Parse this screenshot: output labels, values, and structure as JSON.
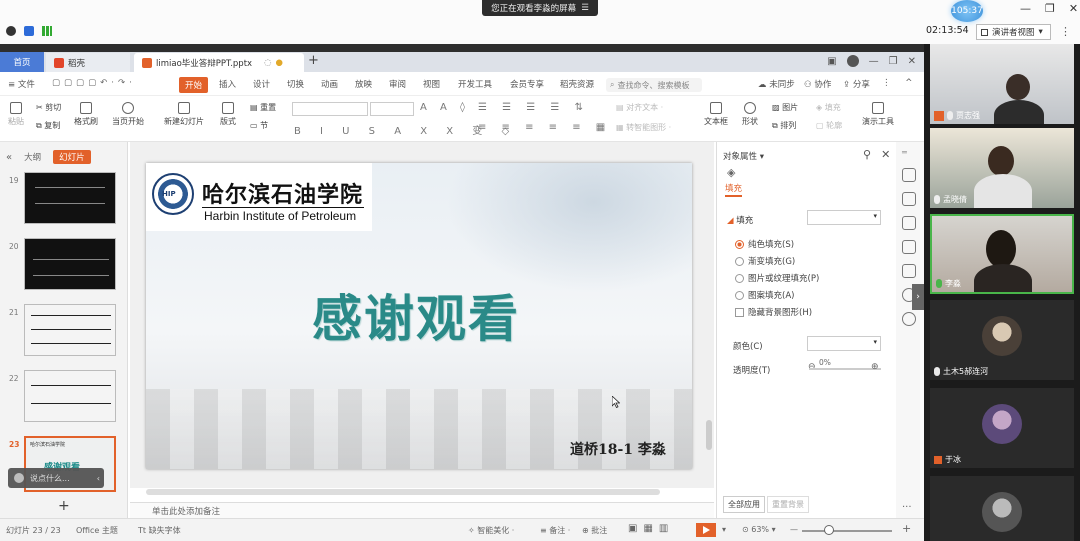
{
  "meeting": {
    "share_banner": "您正在观看李淼的屏幕",
    "timer_badge": "105:37",
    "call_time": "02:13:54",
    "presenter_view": "演讲者视图",
    "win_min": "—",
    "win_restore": "❐",
    "win_close": "✕"
  },
  "tabs": {
    "home": "首页",
    "daoke": "稻壳",
    "file": "limiao毕业答辩PPT.pptx",
    "add": "+"
  },
  "menus": {
    "file": "文件",
    "items": [
      "开始",
      "插入",
      "设计",
      "切换",
      "动画",
      "放映",
      "审阅",
      "视图",
      "开发工具",
      "会员专享",
      "稻壳资源"
    ],
    "search": "查找命令、搜索模板",
    "right": [
      "未同步",
      "协作",
      "分享"
    ]
  },
  "toolbar": {
    "paste": "粘贴",
    "cut": "剪切",
    "copy": "复制",
    "format_painter": "格式刷",
    "from_current": "当页开始",
    "new_slide": "新建幻灯片",
    "layout": "版式",
    "reset": "重置",
    "section": "节",
    "textbox": "文本框",
    "shape": "形状",
    "arrange": "排列",
    "picture": "图片",
    "fill": "填充",
    "outline": "轮廓",
    "presentation_tool": "演示工具"
  },
  "left_panel": {
    "outline_tab": "大纲",
    "slides_tab": "幻灯片",
    "thumb_numbers": [
      "19",
      "20",
      "21",
      "22",
      "23"
    ],
    "thumb23_title": "感谢观看",
    "thumb23_logo": "哈尔滨石油学院",
    "chat_placeholder": "说点什么..."
  },
  "slide": {
    "logo_seal": "HIP",
    "logo_cn": "哈尔滨石油学院",
    "logo_en": "Harbin Institute of Petroleum",
    "title": "感谢观看",
    "author": "道桥18-1  李淼"
  },
  "notes_placeholder": "单击此处添加备注",
  "props": {
    "title": "对象属性",
    "fill_tab": "填充",
    "fill_header": "填充",
    "options": [
      "纯色填充(S)",
      "渐变填充(G)",
      "图片或纹理填充(P)",
      "图案填充(A)"
    ],
    "hide_bg": "隐藏背景图形(H)",
    "color_label": "颜色(C)",
    "transparency_label": "透明度(T)",
    "transparency_value": "0%",
    "apply_all": "全部应用",
    "reset_bg": "重置背景"
  },
  "status": {
    "slide_count": "幻灯片 23 / 23",
    "theme": "Office 主题",
    "missing_font": "缺失字体",
    "smart_beautify": "智能美化",
    "notes": "备注",
    "comments": "批注",
    "zoom": "63%"
  },
  "participants": [
    "贾志强",
    "孟晓倩",
    "李淼",
    "土木5郝连河",
    "于冰"
  ],
  "colors": {
    "accent": "#e2612a",
    "title_teal": "#2a8a88",
    "active_speaker": "#49b54a"
  }
}
